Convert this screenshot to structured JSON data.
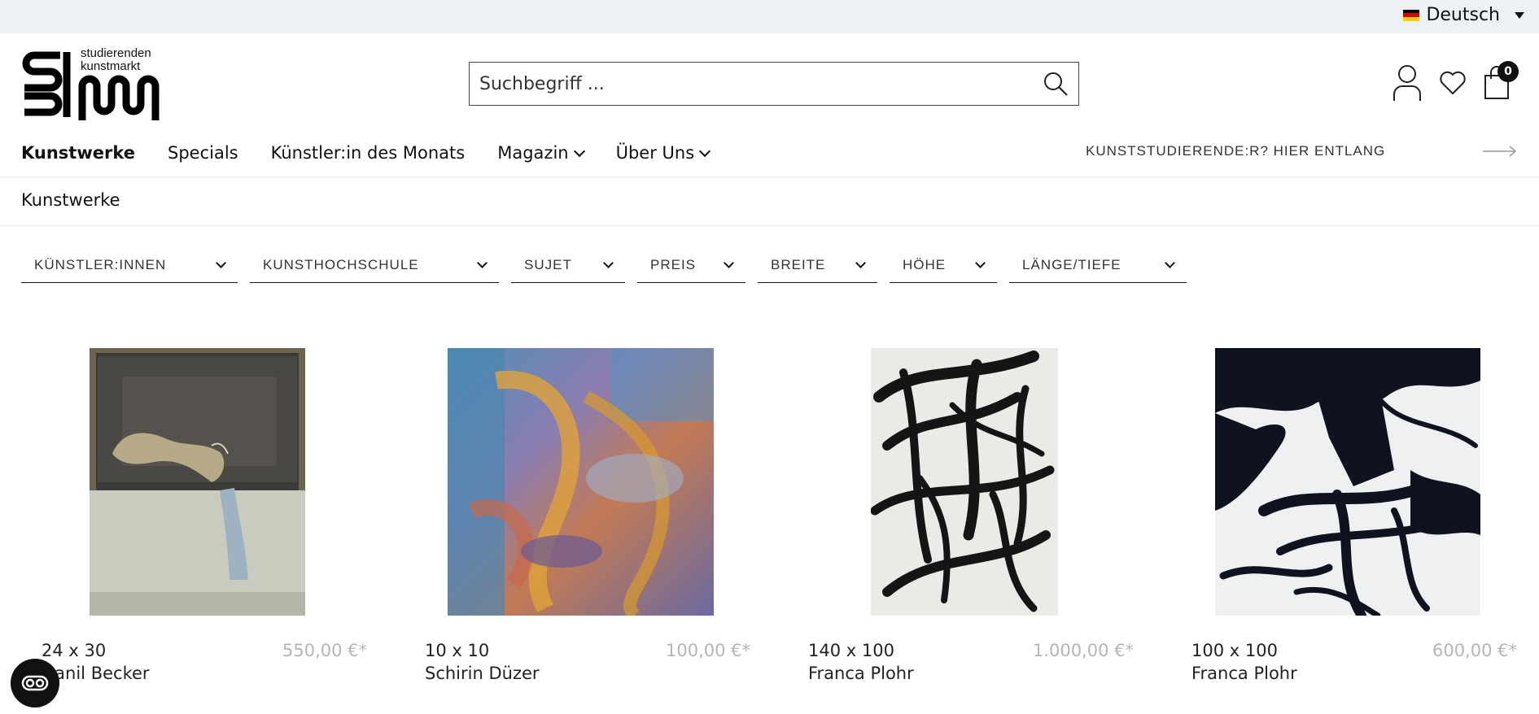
{
  "topbar": {
    "language": "Deutsch"
  },
  "logo": {
    "line1": "studierenden",
    "line2": "kunstmarkt"
  },
  "search": {
    "placeholder": "Suchbegriff ..."
  },
  "cart": {
    "count": "0"
  },
  "nav": {
    "items": [
      {
        "label": "Kunstwerke"
      },
      {
        "label": "Specials"
      },
      {
        "label": "Künstler:in des Monats"
      },
      {
        "label": "Magazin"
      },
      {
        "label": "Über Uns"
      }
    ],
    "promo": "KUNSTSTUDIERENDE:R? HIER ENTLANG"
  },
  "breadcrumb": "Kunstwerke",
  "filters": [
    {
      "label": "KÜNSTLER:INNEN"
    },
    {
      "label": "KUNSTHOCHSCHULE"
    },
    {
      "label": "SUJET"
    },
    {
      "label": "PREIS"
    },
    {
      "label": "BREITE"
    },
    {
      "label": "HÖHE"
    },
    {
      "label": "LÄNGE/TIEFE"
    }
  ],
  "products": [
    {
      "size": "24 x 30",
      "price": "550,00 €*",
      "artist": "Danil Becker"
    },
    {
      "size": "10 x 10",
      "price": "100,00 €*",
      "artist": "Schirin Düzer"
    },
    {
      "size": "140 x 100",
      "price": "1.000,00 €*",
      "artist": "Franca Plohr"
    },
    {
      "size": "100 x 100",
      "price": "600,00 €*",
      "artist": "Franca Plohr"
    }
  ]
}
